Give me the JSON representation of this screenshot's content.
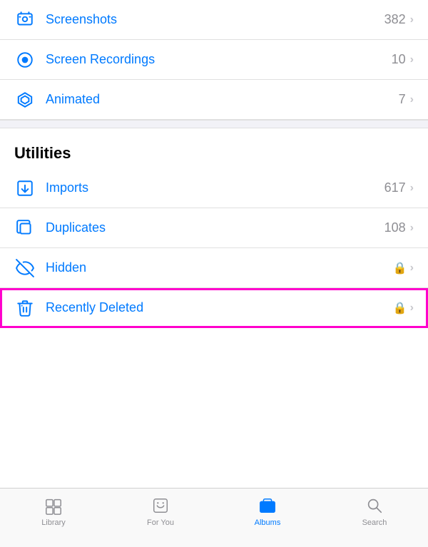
{
  "top_items": [
    {
      "id": "screenshots",
      "label": "Screenshots",
      "count": "382",
      "has_lock": false
    },
    {
      "id": "screen-recordings",
      "label": "Screen Recordings",
      "count": "10",
      "has_lock": false
    },
    {
      "id": "animated",
      "label": "Animated",
      "count": "7",
      "has_lock": false
    }
  ],
  "utilities_header": "Utilities",
  "utility_items": [
    {
      "id": "imports",
      "label": "Imports",
      "count": "617",
      "has_lock": false
    },
    {
      "id": "duplicates",
      "label": "Duplicates",
      "count": "108",
      "has_lock": false
    },
    {
      "id": "hidden",
      "label": "Hidden",
      "count": "",
      "has_lock": true,
      "highlighted": false
    },
    {
      "id": "recently-deleted",
      "label": "Recently Deleted",
      "count": "",
      "has_lock": true,
      "highlighted": true
    }
  ],
  "tabs": [
    {
      "id": "library",
      "label": "Library",
      "active": false
    },
    {
      "id": "for-you",
      "label": "For You",
      "active": false
    },
    {
      "id": "albums",
      "label": "Albums",
      "active": true
    },
    {
      "id": "search",
      "label": "Search",
      "active": false
    }
  ]
}
